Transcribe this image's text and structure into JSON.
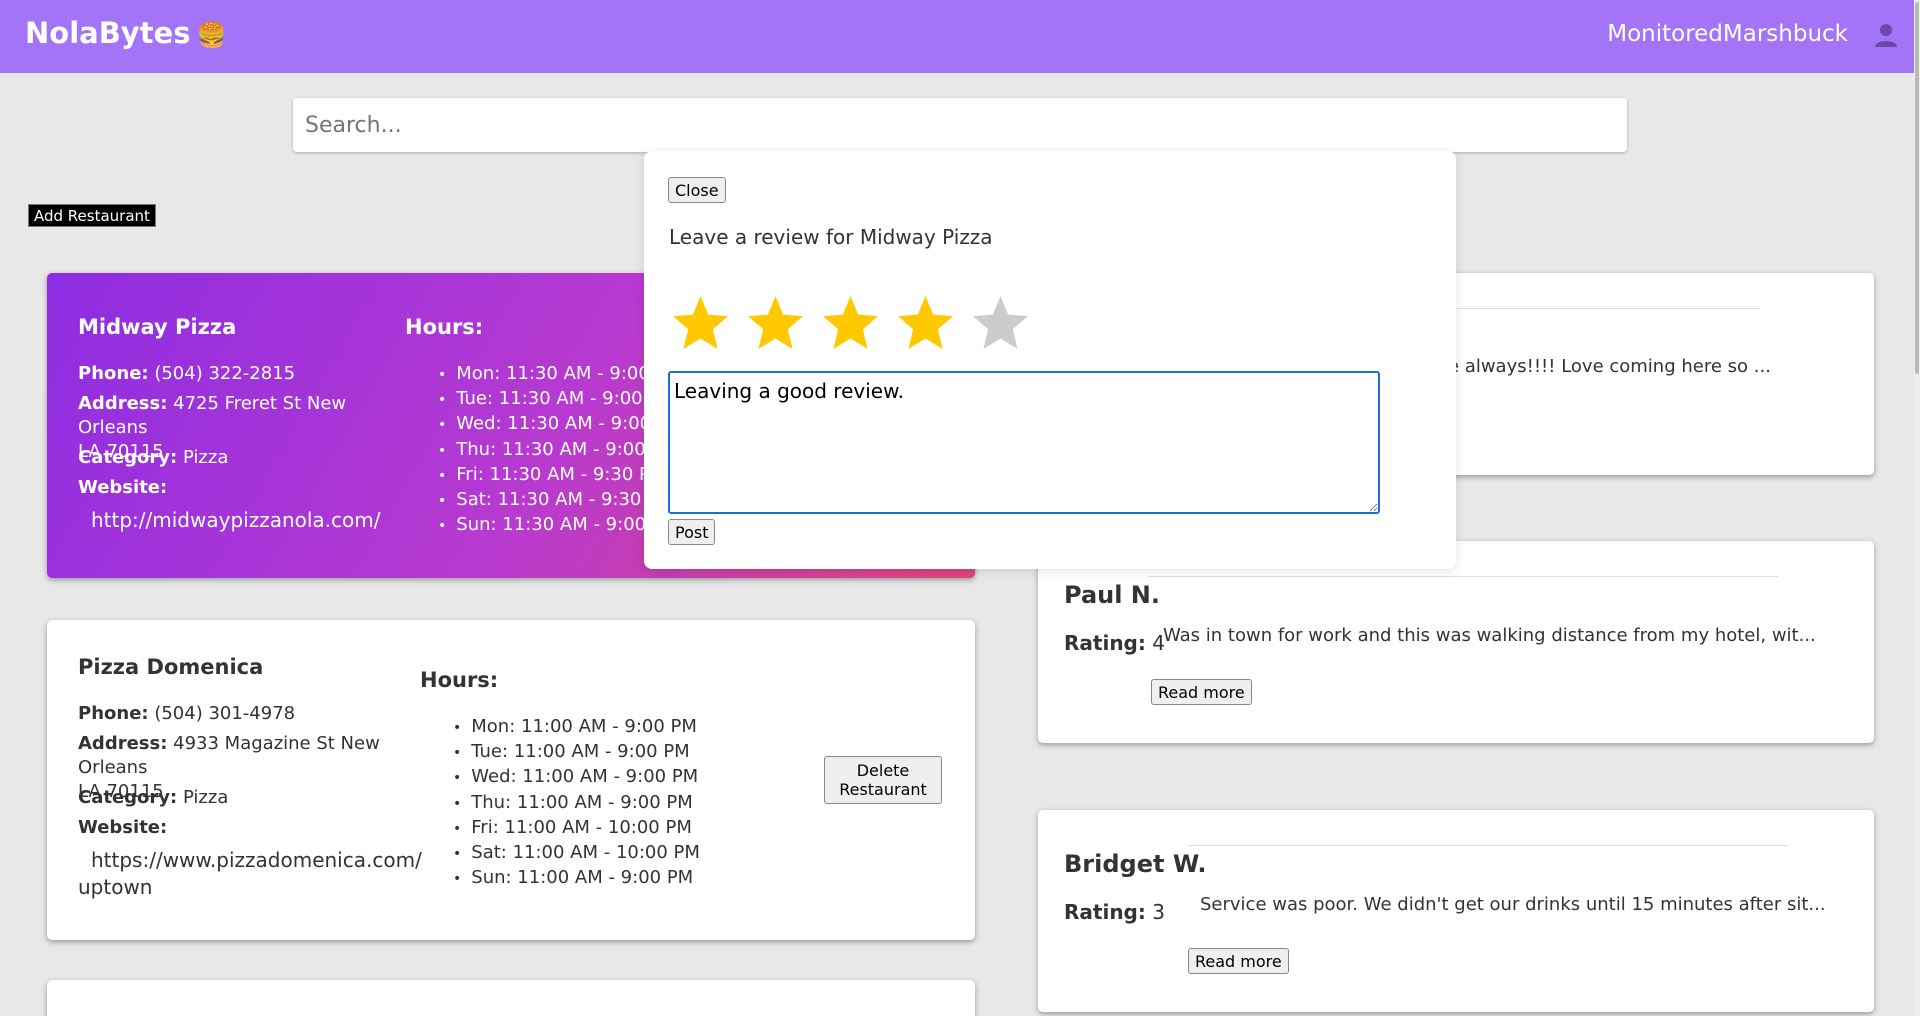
{
  "navbar": {
    "brand": "NolaBytes",
    "brand_icon": "🍔",
    "username": "MonitoredMarshbuck",
    "user_icon": "user-icon",
    "bg_color": "#a374f8"
  },
  "search": {
    "placeholder": "Search..."
  },
  "add_button": "Add Restaurant",
  "restaurants": [
    {
      "name": "Midway Pizza",
      "phone_label": "Phone:",
      "phone": "(504) 322-2815",
      "address_label": "Address:",
      "address_line1": "4725 Freret St New Orleans",
      "address_line2": "LA 70115",
      "category_label": "Category:",
      "category": "Pizza",
      "website_label": "Website:",
      "website": "http://midwaypizzanola.com/",
      "hours_label": "Hours:",
      "hours": [
        "Mon: 11:30 AM - 9:00 PM",
        "Tue: 11:30 AM - 9:00 PM",
        "Wed: 11:30 AM - 9:00 PM",
        "Thu: 11:30 AM - 9:00 PM",
        "Fri: 11:30 AM - 9:30 PM",
        "Sat: 11:30 AM - 9:30 PM",
        "Sun: 11:30 AM - 9:00 PM"
      ]
    },
    {
      "name": "Pizza Domenica",
      "phone_label": "Phone:",
      "phone": "(504) 301-4978",
      "address_label": "Address:",
      "address_line1": "4933 Magazine St New Orleans",
      "address_line2": "LA 70115",
      "category_label": "Category:",
      "category": "Pizza",
      "website_label": "Website:",
      "website_line1": "https://www.pizzadomenica.com/",
      "website_line2": "uptown",
      "hours_label": "Hours:",
      "hours": [
        "Mon: 11:00 AM - 9:00 PM",
        "Tue: 11:00 AM - 9:00 PM",
        "Wed: 11:00 AM - 9:00 PM",
        "Thu: 11:00 AM - 9:00 PM",
        "Fri: 11:00 AM - 10:00 PM",
        "Sat: 11:00 AM - 10:00 PM",
        "Sun: 11:00 AM - 9:00 PM"
      ],
      "delete_label_1": "Delete",
      "delete_label_2": "Restaurant"
    }
  ],
  "reviews": [
    {
      "text": "e always!!!!  Love coming here so ..."
    },
    {
      "name": "Paul N.",
      "rating_label": "Rating:",
      "rating": "4",
      "text": "Was in town for work and this was walking distance from my hotel, wit...",
      "read_more": "Read more"
    },
    {
      "name": "Bridget W.",
      "rating_label": "Rating:",
      "rating": "3",
      "text": "Service was poor. We didn't get our drinks until 15 minutes after sit...",
      "read_more": "Read more"
    }
  ],
  "modal": {
    "close_label": "Close",
    "title": "Leave a review for Midway Pizza",
    "rating_value": 4,
    "rating_max": 5,
    "star_color_filled": "#ffc800",
    "star_color_empty": "#cccccc",
    "review_text": "Leaving a good review.",
    "post_label": "Post"
  }
}
